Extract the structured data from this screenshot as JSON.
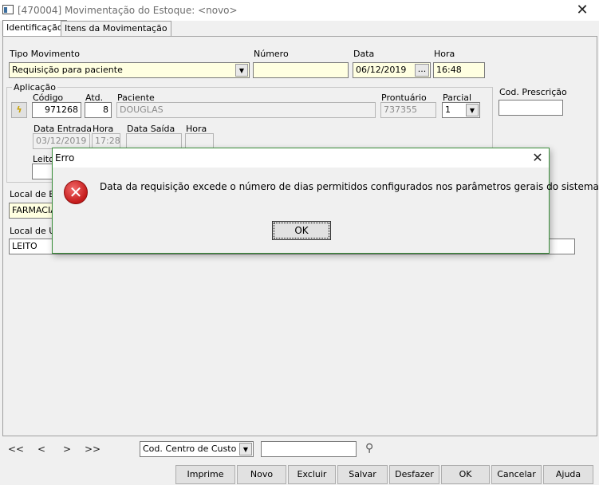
{
  "window": {
    "title": "[470004]  Movimentação do Estoque: <novo>",
    "close_glyph": "✕"
  },
  "tabs": [
    {
      "label": "Identificação"
    },
    {
      "label": "Itens da Movimentação"
    }
  ],
  "form": {
    "tipo_movimento": {
      "label": "Tipo Movimento",
      "value": "Requisição para paciente"
    },
    "numero": {
      "label": "Número",
      "value": ""
    },
    "data": {
      "label": "Data",
      "value": "06/12/2019",
      "button": "..."
    },
    "hora": {
      "label": "Hora",
      "value": "16:48"
    },
    "aplicacao": {
      "group_label": "Aplicação",
      "codigo": {
        "label": "Código",
        "value": "971268"
      },
      "atd": {
        "label": "Atd.",
        "value": "8"
      },
      "paciente": {
        "label": "Paciente",
        "value": "DOUGLAS"
      },
      "prontuario": {
        "label": "Prontuário",
        "value": "737355"
      },
      "parcial": {
        "label": "Parcial",
        "value": "1"
      },
      "data_entrada": {
        "label": "Data Entrada",
        "value": "03/12/2019"
      },
      "hora_entrada": {
        "label": "Hora",
        "value": "17:28"
      },
      "data_saida": {
        "label": "Data Saída",
        "value": ""
      },
      "hora_saida": {
        "label": "Hora",
        "value": ""
      },
      "leito": {
        "label": "Leito",
        "value": ""
      }
    },
    "cod_prescricao": {
      "label": "Cod. Prescrição",
      "value": ""
    },
    "local_estoque": {
      "label": "Local de E",
      "value": "FARMACIA"
    },
    "local_utilizacao": {
      "label": "Local de U",
      "value": "LEITO"
    }
  },
  "dialog": {
    "title": "Erro",
    "message": "Data da requisição excede o número de dias permitidos configurados nos parâmetros gerais do sistema.",
    "ok_label": "OK",
    "close_glyph": "✕",
    "icon_glyph": "✕"
  },
  "navigation": {
    "first": "<<",
    "prev": "<",
    "next": ">",
    "last": ">>",
    "search_field": "Cod. Centro de Custo",
    "search_value": ""
  },
  "buttons": {
    "imprime": "Imprime",
    "novo": "Novo",
    "excluir": "Excluir",
    "salvar": "Salvar",
    "desfazer": "Desfazer",
    "ok": "OK",
    "cancelar": "Cancelar",
    "ajuda": "Ajuda"
  },
  "colors": {
    "yellow_field": "#ffffe1",
    "dialog_border": "#3b8e3b",
    "error_red": "#c41a1a"
  }
}
